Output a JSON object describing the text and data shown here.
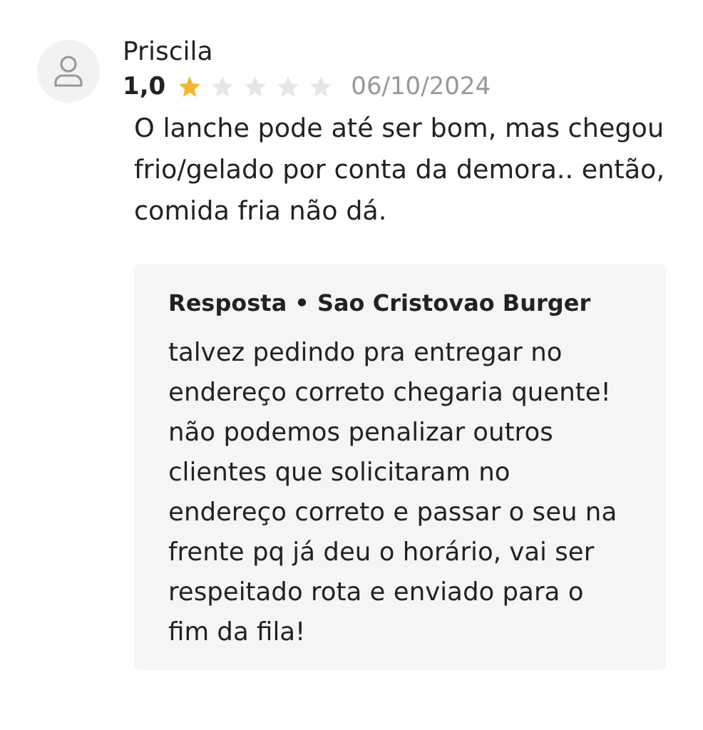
{
  "review": {
    "author": "Priscila",
    "score": "1,0",
    "stars": 1,
    "date": "06/10/2024",
    "text": "O lanche pode até ser bom, mas chegou frio/gelado por conta da demora.. então, comida fria não dá."
  },
  "reply": {
    "title": "Resposta • Sao Cristovao Burger",
    "text": "talvez pedindo pra entregar no endereço correto chegaria quente! não podemos penalizar outros clientes que solicitaram no endereço correto e passar o seu na frente pq já deu o horário, vai ser respeitado rota e enviado para o fim da fila!"
  }
}
